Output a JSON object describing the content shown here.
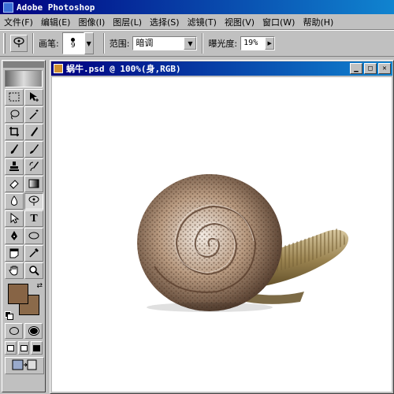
{
  "app": {
    "title": "Adobe Photoshop"
  },
  "menu": [
    "文件(F)",
    "编辑(E)",
    "图像(I)",
    "图层(L)",
    "选择(S)",
    "滤镜(T)",
    "视图(V)",
    "窗口(W)",
    "帮助(H)"
  ],
  "options": {
    "tool_icon": "dodge-tool-icon",
    "brush_label": "画笔:",
    "brush_size": "9",
    "range_label": "范围:",
    "range_value": "暗调",
    "exposure_label": "曝光度:",
    "exposure_value": "19%"
  },
  "toolbox": {
    "tools": [
      {
        "name": "marquee",
        "glyph": "⬚"
      },
      {
        "name": "move",
        "glyph": "✥"
      },
      {
        "name": "lasso",
        "glyph": "ʘ"
      },
      {
        "name": "magic-wand",
        "glyph": "⁄"
      },
      {
        "name": "crop",
        "glyph": "⌗"
      },
      {
        "name": "slice",
        "glyph": "✎"
      },
      {
        "name": "healing-brush",
        "glyph": "✐"
      },
      {
        "name": "brush",
        "glyph": "✏"
      },
      {
        "name": "clone-stamp",
        "glyph": "♙"
      },
      {
        "name": "history-brush",
        "glyph": "⚒"
      },
      {
        "name": "eraser",
        "glyph": "▱"
      },
      {
        "name": "gradient",
        "glyph": "▤"
      },
      {
        "name": "blur",
        "glyph": "💧"
      },
      {
        "name": "dodge",
        "glyph": "◐"
      },
      {
        "name": "path-selection",
        "glyph": "↖"
      },
      {
        "name": "type",
        "glyph": "T"
      },
      {
        "name": "pen",
        "glyph": "✒"
      },
      {
        "name": "ellipse",
        "glyph": "◯"
      },
      {
        "name": "notes",
        "glyph": "▭"
      },
      {
        "name": "eyedropper",
        "glyph": "⁄"
      },
      {
        "name": "hand",
        "glyph": "✋"
      },
      {
        "name": "zoom",
        "glyph": "🔍"
      }
    ],
    "active_tool": "dodge",
    "foreground_color": "#876445",
    "background_color": "#8b6a4a"
  },
  "document": {
    "title": "蜗牛.psd @ 100%(身,RGB)",
    "window_buttons": [
      "minimize",
      "maximize",
      "close"
    ]
  }
}
